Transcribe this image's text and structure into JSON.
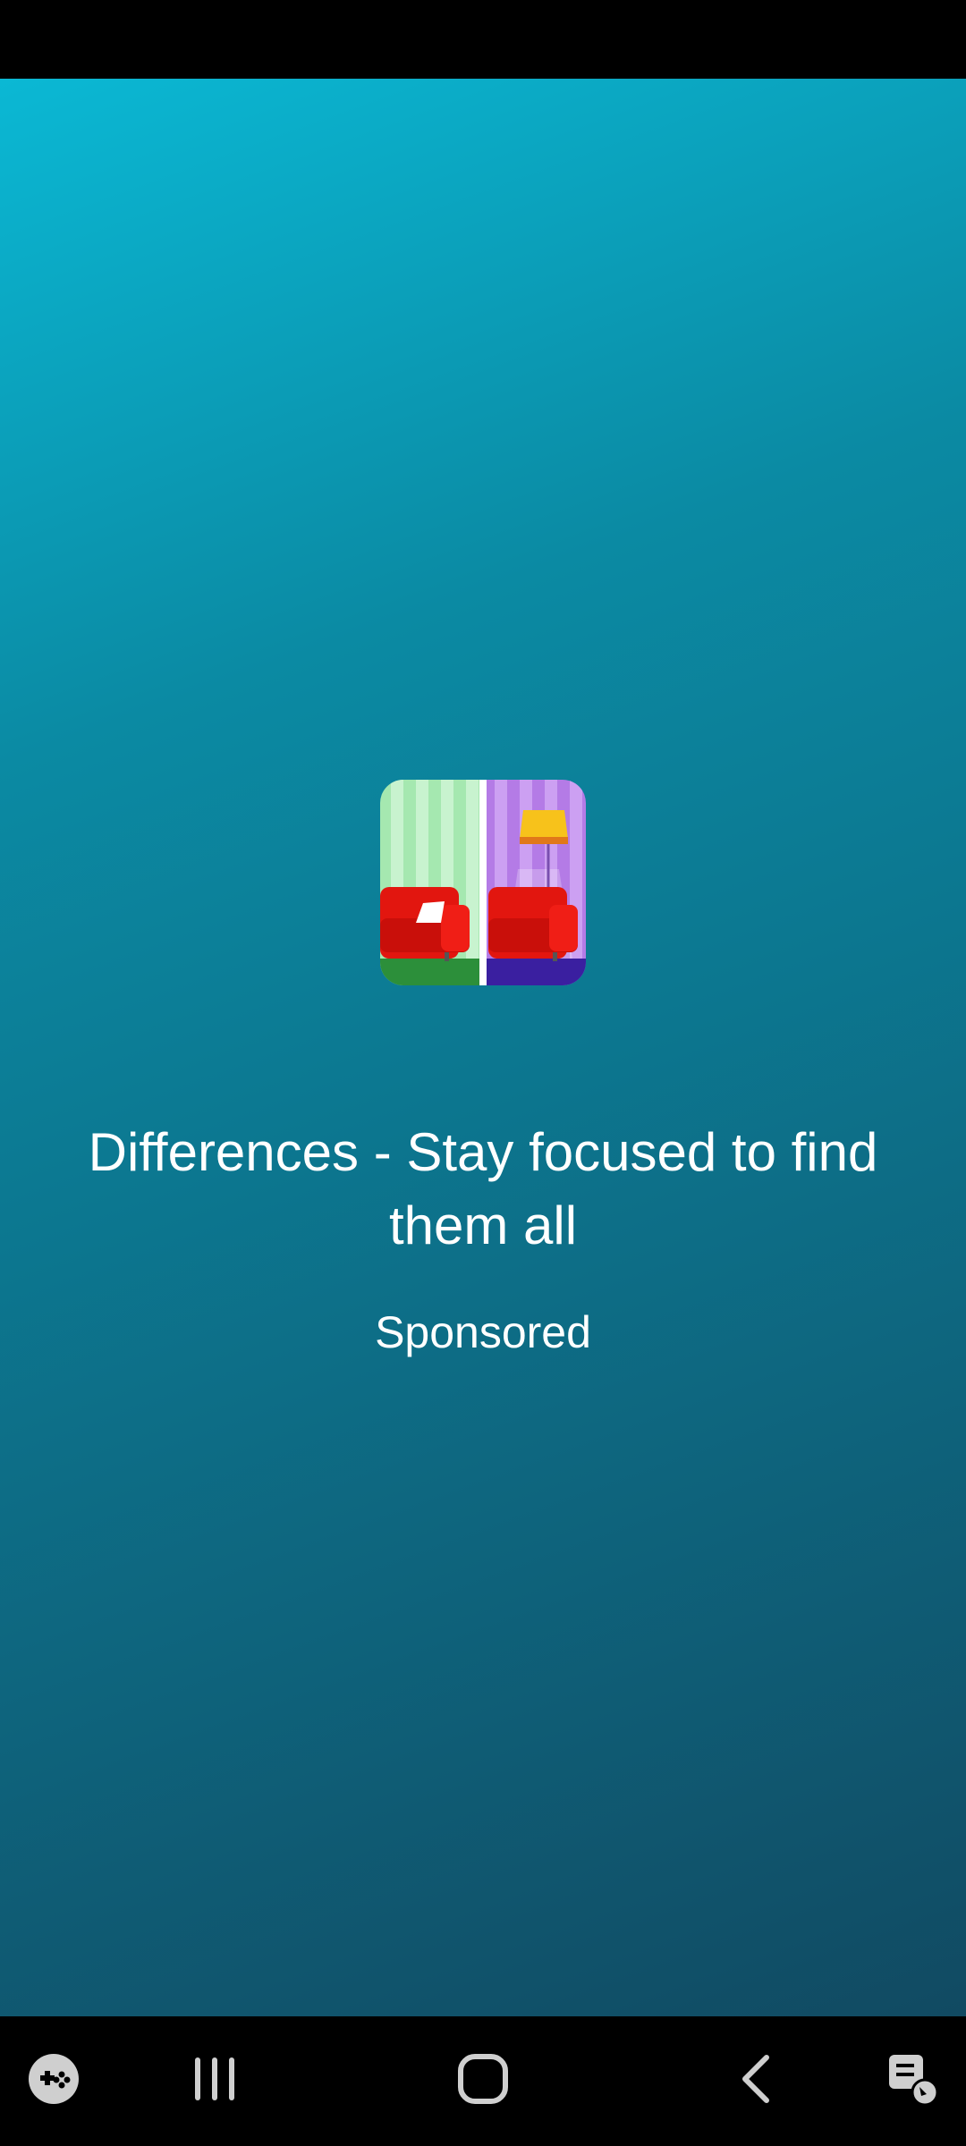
{
  "ad": {
    "app_name": "Differences - Stay focused to find them all",
    "sponsored_label": "Sponsored",
    "icon": "differences-app-icon"
  },
  "colors": {
    "gradient_top": "#0bb8d4",
    "gradient_bottom": "#114a62",
    "text": "#ffffff",
    "system_bar": "#000000"
  },
  "nav_bar": {
    "buttons": [
      {
        "icon": "game-launcher-icon"
      },
      {
        "icon": "recent-apps-icon"
      },
      {
        "icon": "home-icon"
      },
      {
        "icon": "back-icon"
      },
      {
        "icon": "keyboard-switch-icon"
      }
    ]
  }
}
